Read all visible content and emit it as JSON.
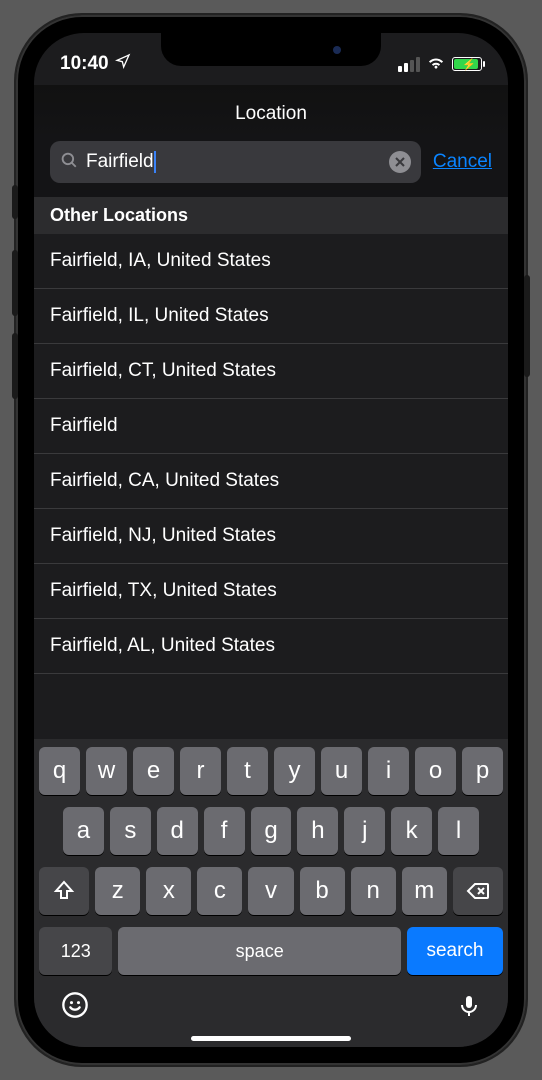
{
  "status": {
    "time": "10:40"
  },
  "nav": {
    "title": "Location"
  },
  "search": {
    "value": "Fairfield",
    "cancel": "Cancel"
  },
  "section_header": "Other Locations",
  "results": [
    "Fairfield, IA, United States",
    "Fairfield, IL, United States",
    "Fairfield, CT, United States",
    "Fairfield",
    "Fairfield, CA, United States",
    "Fairfield, NJ, United States",
    "Fairfield, TX, United States",
    "Fairfield, AL, United States"
  ],
  "keyboard": {
    "row1": [
      "q",
      "w",
      "e",
      "r",
      "t",
      "y",
      "u",
      "i",
      "o",
      "p"
    ],
    "row2": [
      "a",
      "s",
      "d",
      "f",
      "g",
      "h",
      "j",
      "k",
      "l"
    ],
    "row3": [
      "z",
      "x",
      "c",
      "v",
      "b",
      "n",
      "m"
    ],
    "numbers": "123",
    "space": "space",
    "action": "search"
  }
}
